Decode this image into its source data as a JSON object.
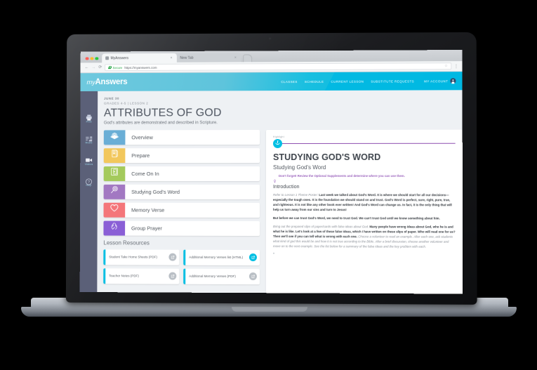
{
  "browser": {
    "tabs": [
      {
        "title": "MyAnswers",
        "active": true
      },
      {
        "title": "New Tab",
        "active": false
      }
    ],
    "close_glyph": "×",
    "back_glyph": "←",
    "forward_glyph": "→",
    "reload_glyph": "⟳",
    "secure_label": "Secure",
    "url": "https://myanswers.com",
    "star_glyph": "☆",
    "menu_glyph": "⋮"
  },
  "header": {
    "logo_prefix": "my",
    "logo_main": "Answers",
    "nav": [
      {
        "label": "CLASSES"
      },
      {
        "label": "SCHEDULE"
      },
      {
        "label": "CURRENT LESSON"
      },
      {
        "label": "SUBSTITUTE REQUESTS"
      }
    ],
    "account_label": "MY ACCOUNT",
    "accent_color": "#00bfe3"
  },
  "rail": {
    "items": [
      {
        "label": "Print",
        "icon": "printer-icon"
      },
      {
        "label": "Music",
        "icon": "music-note-icon"
      },
      {
        "label": "Videos",
        "icon": "video-camera-icon"
      },
      {
        "label": "Help",
        "icon": "question-mark-icon"
      }
    ]
  },
  "lesson": {
    "date": "JUNE 30",
    "grades": "GRADES 4-5 | LESSON 2",
    "title": "ATTRIBUTES OF GOD",
    "subtitle": "God's attributes are demonstrated and described in Scripture."
  },
  "sections": [
    {
      "label": "Overview",
      "color": "#6aaed6",
      "icon": "open-book-icon"
    },
    {
      "label": "Prepare",
      "color": "#f2c75c",
      "icon": "closed-book-icon"
    },
    {
      "label": "Come On In",
      "color": "#a4ca5c",
      "icon": "open-door-icon"
    },
    {
      "label": "Studying God's Word",
      "color": "#a278c2",
      "icon": "magnifier-icon"
    },
    {
      "label": "Memory Verse",
      "color": "#f4767a",
      "icon": "heart-icon"
    },
    {
      "label": "Group Prayer",
      "color": "#8a5fd6",
      "icon": "praying-hands-icon"
    }
  ],
  "resources": {
    "heading": "Lesson Resources",
    "items": [
      {
        "label": "Student Take Home Sheets (PDF)",
        "button_color": "#b9bfc5"
      },
      {
        "label": "Additional Memory Verses list (HTML)",
        "button_color": "#00bfe3"
      },
      {
        "label": "Teacher Notes (PDF)",
        "button_color": "#b9bfc5"
      },
      {
        "label": "Additional Memory Verses (PDF)",
        "button_color": "#b9bfc5"
      }
    ]
  },
  "panel": {
    "highlight_tag": "Highlight",
    "title": "STUDYING GOD'S WORD",
    "subtitle": "Studying God's Word",
    "tip": "Don't forget! Review the Optional Supplements and determine where you can use them.",
    "section_heading": "Introduction",
    "p1_italic": "Refer to Lesson 1 Theme Poster:",
    "p1_bold": "Last week we talked about God's Word. It is where we should start for all our decisions—especially the tough ones. It is the foundation we should stand on and trust. God's Word is perfect, sure, right, pure, true, and righteous. It is not like any other book ever written! And God's Word can change us. In fact, it is the only thing that will help us turn away from our sins and turn to Jesus!",
    "p2_bold": "But before we can trust God's Word, we need to trust God. We can't trust God until we know something about him.",
    "p3_italic": "Bring out the prepared slips of paper/cards with false ideas about God.",
    "p3_bold": "Many people have wrong ideas about God, who he is and what he is like. Let's look at a few of these false ideas, which I have written on these slips of paper. Who will read one for us? Then we'll see if you can tell what is wrong with each one.",
    "p3_tail": "Choose a volunteer to read an example. After each one, ask students what kind of god this would be and how it is not true according to the Bible. After a brief discussion, choose another volunteer and move on to the next example. See the list below for a summary of the false ideas and the key problem with each.",
    "rule_color": "#8e4fb0"
  }
}
